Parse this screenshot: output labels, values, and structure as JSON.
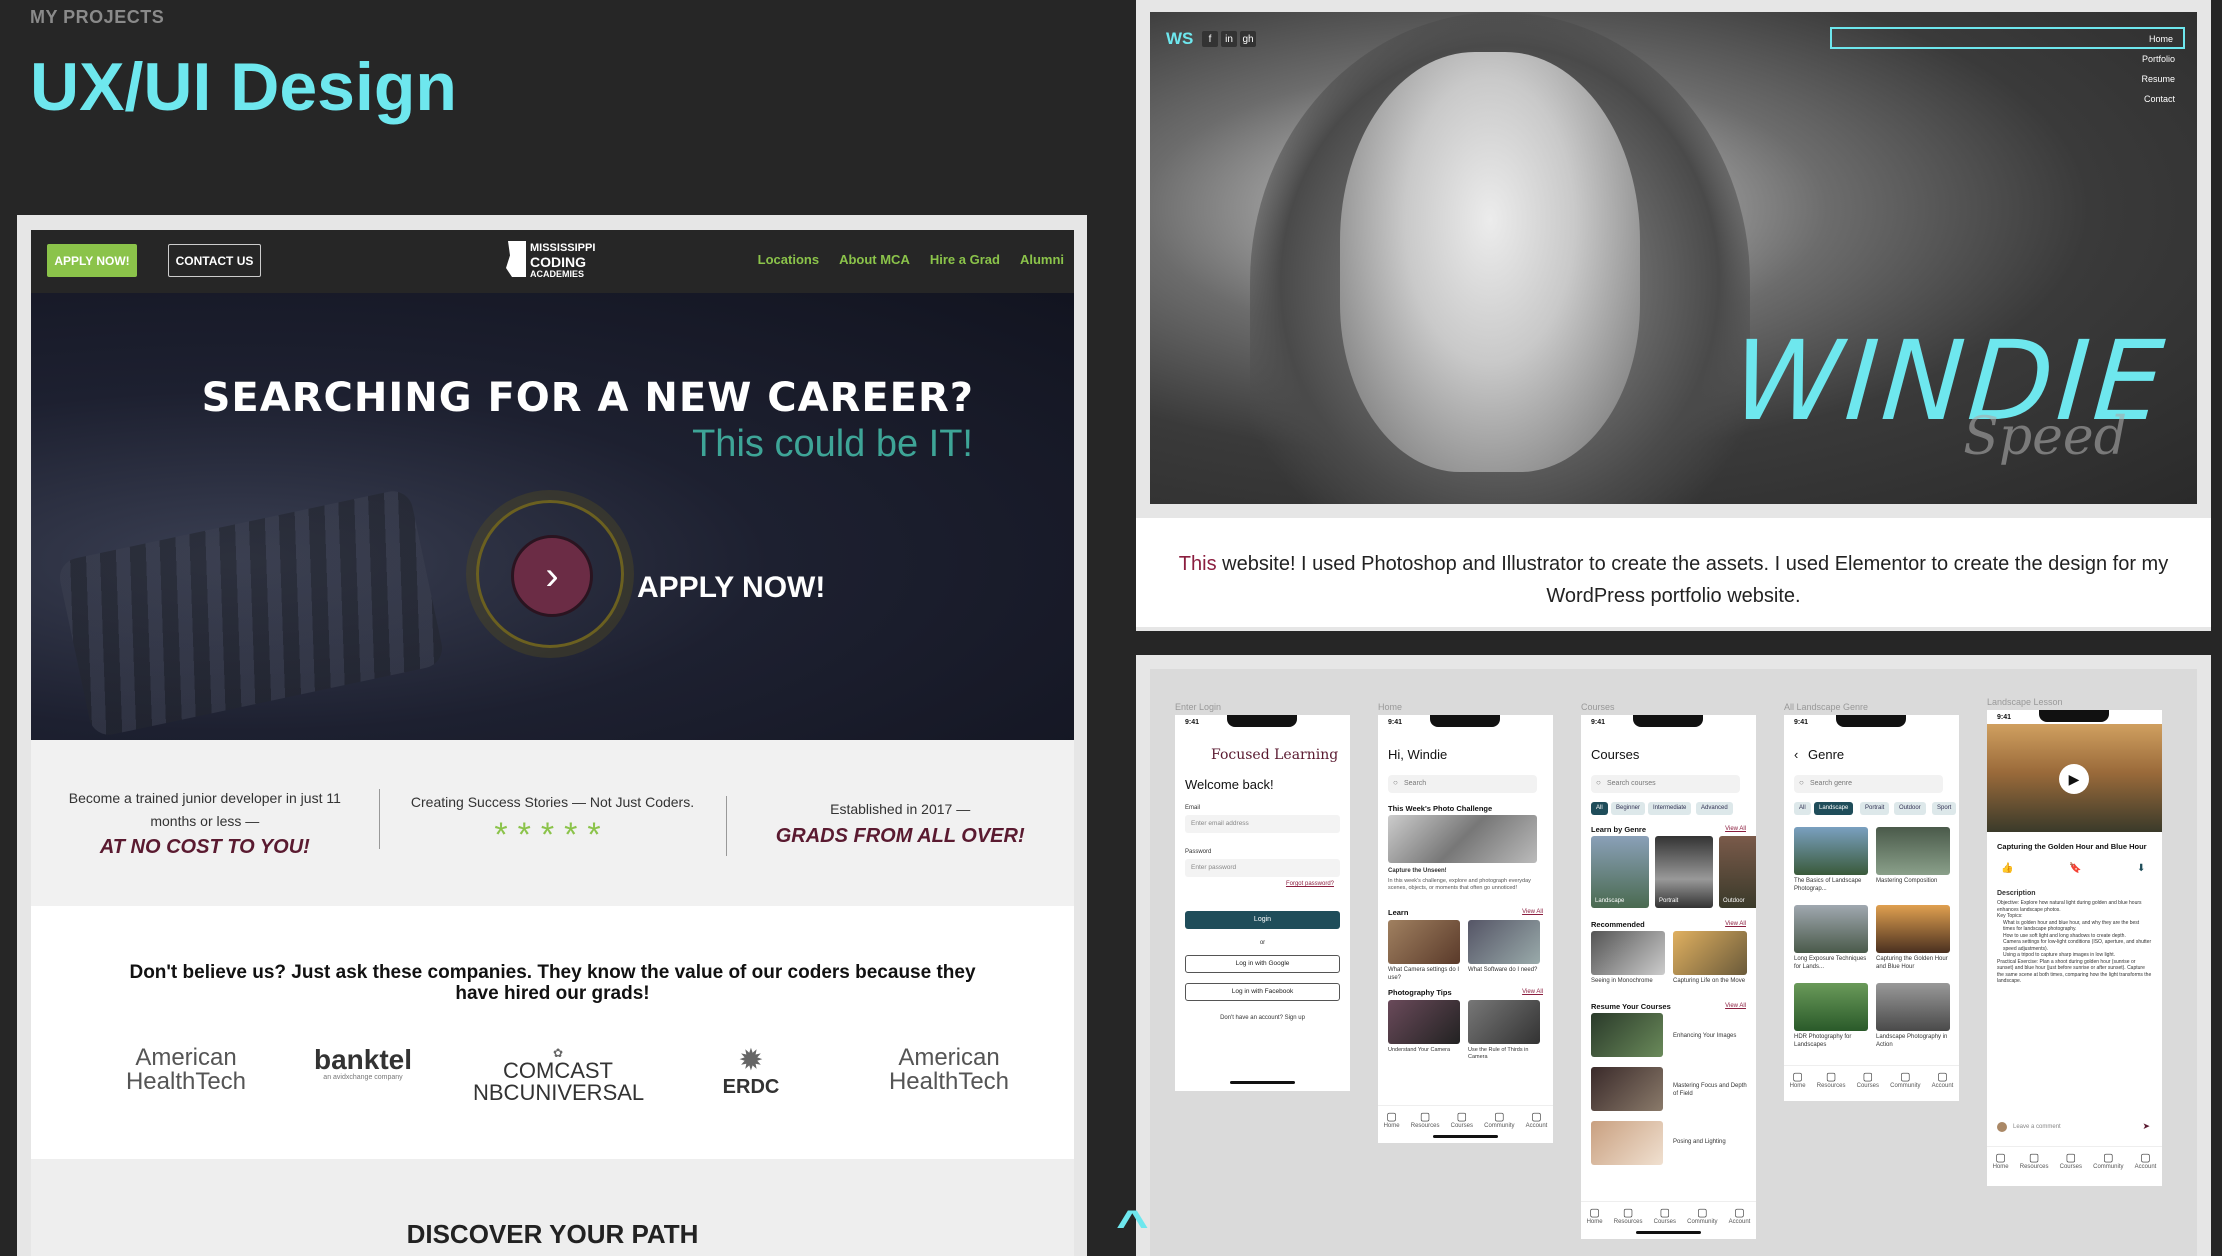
{
  "header": {
    "eyebrow": "MY PROJECTS",
    "title": "UX/UI Design"
  },
  "mca": {
    "nav": {
      "apply_label": "APPLY NOW!",
      "contact_label": "CONTACT US",
      "logo_line1": "MISSISSIPPI",
      "logo_line2": "CODING",
      "logo_line3": "ACADEMIES",
      "links": [
        "Locations",
        "About MCA",
        "Hire a Grad",
        "Alumni"
      ]
    },
    "hero": {
      "headline": "SEARCHING FOR A NEW CAREER?",
      "subhead": "This could be IT!",
      "cta": "APPLY NOW!",
      "arrow": "›"
    },
    "stats": [
      {
        "small": "Become a trained junior developer in just 11 months or less —",
        "big": "AT NO COST TO YOU!"
      },
      {
        "small": "Creating Success Stories — Not Just Coders.",
        "stars": "*****"
      },
      {
        "small": "Established in 2017 —",
        "big": "GRADS FROM ALL OVER!"
      }
    ],
    "companies": {
      "text": "Don't believe us? Just ask these companies. They know the value of our coders because they have hired our grads!",
      "logos": [
        {
          "l1": "American",
          "l2": "HealthTech"
        },
        {
          "l1": "banktel",
          "l2": "an avidxchange company"
        },
        {
          "l1": "COMCAST",
          "l2": "NBCUNIVERSAL"
        },
        {
          "l1": "ERDC",
          "l2": ""
        },
        {
          "l1": "American",
          "l2": "HealthTech"
        }
      ]
    },
    "path_title": "DISCOVER YOUR PATH"
  },
  "ws": {
    "logo": "WS",
    "social": [
      "f",
      "in",
      "gh"
    ],
    "menu": [
      "Home",
      "Portfolio",
      "Resume",
      "Contact"
    ],
    "name": "WINDIE",
    "script": "Speed",
    "caption_highlight": "This",
    "caption_rest": " website! I used Photoshop and Illustrator to create the assets. I used Elementor to create the design for my WordPress portfolio website."
  },
  "figma": {
    "frames": [
      "Enter Login",
      "Home",
      "Courses",
      "All Landscape Genre",
      "Landscape Lesson"
    ],
    "time": "9:41",
    "login": {
      "brand": "Focused Learning",
      "welcome": "Welcome back!",
      "email_label": "Email",
      "email_placeholder": "Enter email address",
      "password_label": "Password",
      "password_placeholder": "Enter password",
      "forgot": "Forgot password?",
      "login_btn": "Login",
      "or": "or",
      "google": "Log in with Google",
      "facebook": "Log in with Facebook",
      "signup": "Don't have an account? Sign up"
    },
    "home": {
      "greeting": "Hi, Windie",
      "search": "Search",
      "challenge_title": "This Week's Photo Challenge",
      "challenge_name": "Capture the Unseen!",
      "challenge_desc": "In this week's challenge, explore and photograph everyday scenes, objects, or moments that often go unnoticed!",
      "learn": "Learn",
      "view_all": "View All",
      "learn_items": [
        "What Camera settings do I use?",
        "What Software do I need?"
      ],
      "tips": "Photography Tips",
      "tip_items": [
        "Understand Your Camera",
        "Use the Rule of Thirds in Camera"
      ]
    },
    "courses": {
      "title": "Courses",
      "search": "Search courses",
      "chips": [
        "All",
        "Beginner",
        "Intermediate",
        "Advanced"
      ],
      "by_genre": "Learn by Genre",
      "genres": [
        "Landscape",
        "Portrait",
        "Outdoor"
      ],
      "recommended": "Recommended",
      "rec_items": [
        "Seeing in Monochrome",
        "Capturing Life on the Move"
      ],
      "resume": "Resume Your Courses",
      "resume_items": [
        "Enhancing Your Images",
        "Mastering Focus and Depth of Field",
        "Posing and Lighting"
      ]
    },
    "genre": {
      "title": "Genre",
      "search": "Search genre",
      "chips": [
        "All",
        "Landscape",
        "Portrait",
        "Outdoor",
        "Sport"
      ],
      "items": [
        "The Basics of Landscape Photograp...",
        "Mastering Composition",
        "Long Exposure Techniques for Lands...",
        "Capturing the Golden Hour and Blue Hour",
        "HDR Photography for Landscapes",
        "Landscape Photography in Action"
      ]
    },
    "lesson": {
      "title": "Capturing the Golden Hour and Blue Hour",
      "desc_label": "Description",
      "bullets": [
        "Objective: Explore how natural light during golden and blue hours enhances landscape photos.",
        "Key Topics:",
        "What is golden hour and blue hour, and why they are the best times for landscape photography.",
        "How to use soft light and long shadows to create depth.",
        "Camera settings for low-light conditions (ISO, aperture, and shutter speed adjustments).",
        "Using a tripod to capture sharp images in low light.",
        "Practical Exercise: Plan a shoot during golden hour (sunrise or sunset) and blue hour (just before sunrise or after sunset). Capture the same scene at both times, comparing how the light transforms the landscape."
      ],
      "comment": "Leave a comment"
    },
    "tabs": [
      "Home",
      "Resources",
      "Courses",
      "Community",
      "Account"
    ]
  }
}
